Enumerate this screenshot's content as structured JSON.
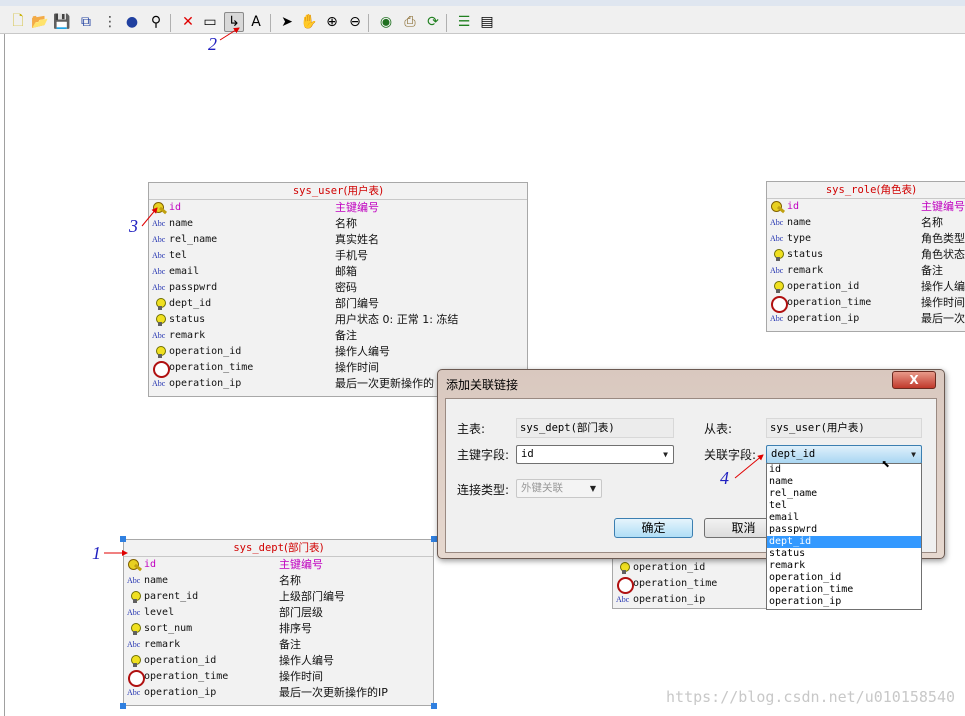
{
  "toolbar": {
    "items": [
      {
        "name": "new-icon",
        "glyph": "🗋",
        "color": "#c8b000"
      },
      {
        "name": "open-icon",
        "glyph": "📂",
        "color": "#c09030"
      },
      {
        "name": "save-icon",
        "glyph": "💾",
        "color": "#303030"
      },
      {
        "name": "copy-icon",
        "glyph": "⧉",
        "color": "#2040a0"
      },
      {
        "name": "tree-icon",
        "glyph": "⋮",
        "color": "#404040"
      },
      {
        "name": "globe-icon",
        "glyph": "●",
        "color": "#2040a0"
      },
      {
        "name": "binoculars-icon",
        "glyph": "⚲",
        "color": "#000"
      },
      {
        "name": "delete-icon",
        "glyph": "✕",
        "color": "#e00000"
      },
      {
        "name": "table-icon",
        "glyph": "▭",
        "color": "#000"
      },
      {
        "name": "link-icon",
        "glyph": "↳",
        "color": "#000",
        "active": true
      },
      {
        "name": "text-icon",
        "glyph": "A",
        "color": "#000"
      },
      {
        "name": "pointer-icon",
        "glyph": "➤",
        "color": "#000"
      },
      {
        "name": "hand-icon",
        "glyph": "✋",
        "color": "#000"
      },
      {
        "name": "zoom-in-icon",
        "glyph": "⊕",
        "color": "#000"
      },
      {
        "name": "zoom-out-icon",
        "glyph": "⊖",
        "color": "#000"
      },
      {
        "name": "eye-icon",
        "glyph": "◉",
        "color": "#207020"
      },
      {
        "name": "export-icon",
        "glyph": "⎙",
        "color": "#806020"
      },
      {
        "name": "refresh-icon",
        "glyph": "⟳",
        "color": "#208020"
      },
      {
        "name": "add-field-icon",
        "glyph": "☰",
        "color": "#208020"
      },
      {
        "name": "properties-icon",
        "glyph": "▤",
        "color": "#000"
      }
    ]
  },
  "entities": {
    "sys_user": {
      "name": "sys_user",
      "cn": "(用户表)",
      "fields": [
        {
          "n": "id",
          "c": "主键编号",
          "t": "key",
          "pk": true
        },
        {
          "n": "name",
          "c": "名称",
          "t": "abc"
        },
        {
          "n": "rel_name",
          "c": "真实姓名",
          "t": "abc"
        },
        {
          "n": "tel",
          "c": "手机号",
          "t": "abc"
        },
        {
          "n": "email",
          "c": "邮箱",
          "t": "abc"
        },
        {
          "n": "passpwrd",
          "c": "密码",
          "t": "abc"
        },
        {
          "n": "dept_id",
          "c": "部门编号",
          "t": "bulb"
        },
        {
          "n": "status",
          "c": "用户状态 0: 正常  1: 冻结",
          "t": "bulb"
        },
        {
          "n": "remark",
          "c": "备注",
          "t": "abc"
        },
        {
          "n": "operation_id",
          "c": "操作人编号",
          "t": "bulb"
        },
        {
          "n": "operation_time",
          "c": "操作时间",
          "t": "clock"
        },
        {
          "n": "operation_ip",
          "c": "最后一次更新操作的",
          "t": "abc"
        }
      ]
    },
    "sys_role": {
      "name": "sys_role",
      "cn": "(角色表)",
      "fields": [
        {
          "n": "id",
          "c": "主键编号",
          "t": "key",
          "pk": true
        },
        {
          "n": "name",
          "c": "名称",
          "t": "abc"
        },
        {
          "n": "type",
          "c": "角色类型",
          "t": "abc"
        },
        {
          "n": "status",
          "c": "角色状态",
          "t": "bulb"
        },
        {
          "n": "remark",
          "c": "备注",
          "t": "abc"
        },
        {
          "n": "operation_id",
          "c": "操作人编号",
          "t": "bulb"
        },
        {
          "n": "operation_time",
          "c": "操作时间",
          "t": "clock"
        },
        {
          "n": "operation_ip",
          "c": "最后一次",
          "t": "abc"
        }
      ]
    },
    "sys_dept": {
      "name": "sys_dept",
      "cn": "(部门表)",
      "fields": [
        {
          "n": "id",
          "c": "主键编号",
          "t": "key",
          "pk": true
        },
        {
          "n": "name",
          "c": "名称",
          "t": "abc"
        },
        {
          "n": "parent_id",
          "c": "上级部门编号",
          "t": "bulb"
        },
        {
          "n": "level",
          "c": "部门层级",
          "t": "abc"
        },
        {
          "n": "sort_num",
          "c": "排序号",
          "t": "bulb"
        },
        {
          "n": "remark",
          "c": "备注",
          "t": "abc"
        },
        {
          "n": "operation_id",
          "c": "操作人编号",
          "t": "bulb"
        },
        {
          "n": "operation_time",
          "c": "操作时间",
          "t": "clock"
        },
        {
          "n": "operation_ip",
          "c": "最后一次更新操作的IP",
          "t": "abc"
        }
      ]
    },
    "hidden": {
      "fields": [
        {
          "n": "operation_id",
          "t": "bulb"
        },
        {
          "n": "operation_time",
          "t": "clock"
        },
        {
          "n": "operation_ip",
          "t": "abc"
        }
      ]
    }
  },
  "dialog": {
    "title": "添加关联链接",
    "close": "X",
    "master_label": "主表:",
    "master_value": "sys_dept(部门表)",
    "slave_label": "从表:",
    "slave_value": "sys_user(用户表)",
    "pk_label": "主键字段:",
    "pk_value": "id",
    "fk_label": "关联字段:",
    "fk_value": "dept_id",
    "join_label": "连接类型:",
    "join_value": "外键关联",
    "ok": "确定",
    "cancel": "取消",
    "fk_options": [
      "id",
      "name",
      "rel_name",
      "tel",
      "email",
      "passpwrd",
      "dept_id",
      "status",
      "remark",
      "operation_id",
      "operation_time",
      "operation_ip"
    ],
    "fk_selected": "dept_id"
  },
  "annotations": {
    "a1": "1",
    "a2": "2",
    "a3": "3",
    "a4": "4"
  },
  "watermark": "https://blog.csdn.net/u010158540"
}
